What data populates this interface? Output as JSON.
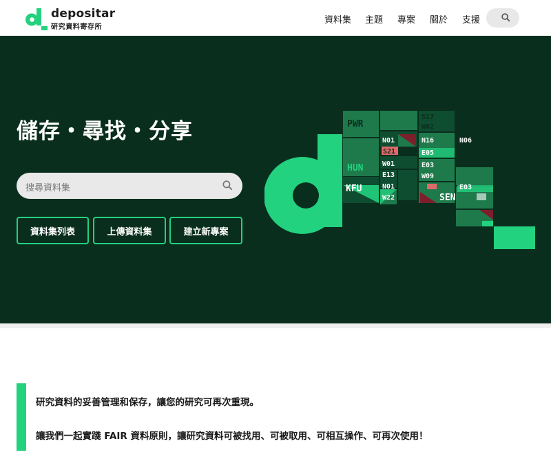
{
  "brand": {
    "name": "depositar",
    "subtitle": "研究資料寄存所",
    "accent": "#22d27f",
    "dark": "#0a2e1e"
  },
  "nav": {
    "items": [
      {
        "label": "資料集"
      },
      {
        "label": "主題"
      },
      {
        "label": "專案"
      },
      {
        "label": "關於"
      },
      {
        "label": "支援"
      }
    ],
    "search_icon": "search-icon"
  },
  "hero": {
    "title": "儲存・尋找・分享",
    "search_placeholder": "搜尋資料集",
    "buttons": [
      {
        "label": "資料集列表"
      },
      {
        "label": "上傳資料集"
      },
      {
        "label": "建立新專案"
      }
    ],
    "map_labels": [
      "PWR",
      "S17",
      "W02",
      "N01",
      "N16",
      "N06",
      "S21",
      "E05",
      "HUN",
      "W01",
      "E03",
      "E13",
      "W09",
      "KFU",
      "N01",
      "E03",
      "W22",
      "SEN"
    ]
  },
  "mission": {
    "line1": "研究資料的妥善管理和保存，讓您的研究可再次重現。",
    "line2": "讓我們一起實踐 FAIR 資料原則，讓研究資料可被找用、可被取用、可相互操作、可再次使用！"
  }
}
